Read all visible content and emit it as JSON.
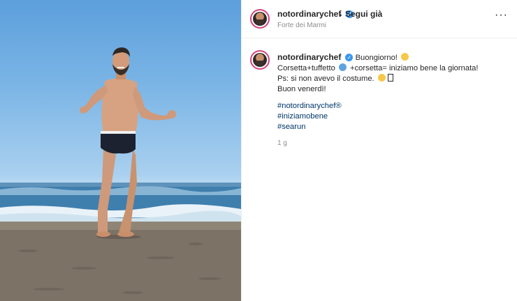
{
  "post": {
    "username": "notordinarychef",
    "verified_mark": "✓",
    "follow_status": "Segui già",
    "separator": "•",
    "location": "Forte dei Marmi",
    "more_icon": "···"
  },
  "caption": {
    "username": "notordinarychef",
    "line1": "Buongiorno!",
    "line2_a": "Corsetta+tuffetto",
    "line2_b": "+corsetta= iniziamo bene la giornata!",
    "line3": "Ps: si non avevo il costume.",
    "line4": "Buon venerdì!",
    "hashtags": [
      "#notordinarychef®",
      "#iniziamobene",
      "#searun"
    ],
    "timestamp": "1 g"
  },
  "icons": {
    "verified": "verified-badge-icon",
    "more": "more-options-icon",
    "emoji_smile": "smiling-face-emoji",
    "emoji_blue": "blue-face-emoji",
    "emoji_laugh": "laughing-face-emoji"
  },
  "colors": {
    "accent_link": "#00376b",
    "verified_blue": "#3897f0",
    "avatar_ring": "#d4447a",
    "muted_text": "#8e8e8e"
  }
}
